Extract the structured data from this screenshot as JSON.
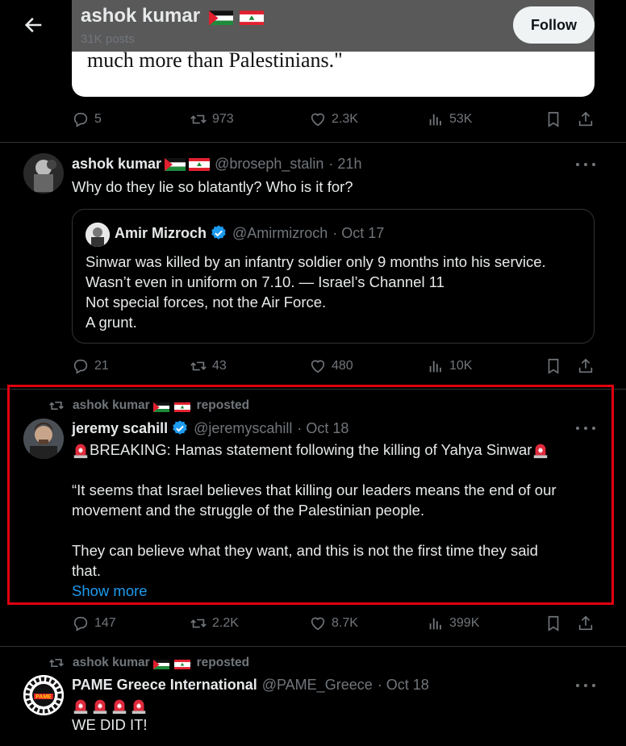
{
  "header": {
    "name": "ashok kumar",
    "posts": "31K posts",
    "follow_label": "Follow"
  },
  "top_card": {
    "text": "much more than Palestinians.\""
  },
  "action_bar_1": {
    "replies": "5",
    "reposts": "973",
    "likes": "2.3K",
    "views": "53K"
  },
  "tweet2": {
    "name": "ashok kumar",
    "handle": "@broseph_stalin",
    "time": "· 21h",
    "text": "Why do they lie so blatantly? Who is it for?",
    "quote": {
      "name": "Amir Mizroch",
      "handle": "@Amirmizroch",
      "time": "· Oct 17",
      "lines": [
        "Sinwar was killed by an infantry soldier only 9 months into his service.",
        "Wasn’t even in uniform on 7.10. — Israel’s Channel 11",
        "Not special forces, not the Air Force.",
        "A grunt."
      ]
    },
    "actions": {
      "replies": "21",
      "reposts": "43",
      "likes": "480",
      "views": "10K"
    }
  },
  "tweet3": {
    "social": "ashok kumar",
    "social_suffix": "reposted",
    "name": "jeremy scahill",
    "handle": "@jeremyscahill",
    "time": "· Oct 18",
    "line1": "BREAKING: Hamas statement following the killing of Yahya Sinwar",
    "para1_l1": "“It seems that Israel believes that killing our leaders means the end of our",
    "para1_l2": "movement and the struggle of the Palestinian people.",
    "para2_l1": "They can believe what they want, and this is not the first time they said",
    "para2_l2": "that.",
    "show_more": "Show more",
    "actions": {
      "replies": "147",
      "reposts": "2.2K",
      "likes": "8.7K",
      "views": "399K"
    }
  },
  "tweet4": {
    "social": "ashok kumar",
    "social_suffix": "reposted",
    "name": "PAME Greece International",
    "handle": "@PAME_Greece",
    "time": "· Oct 18",
    "text": "WE DID IT!",
    "avatar_text": "PAME"
  },
  "colors": {
    "accent": "#1d9bf0",
    "highlight": "#e0000f",
    "muted": "#71767b",
    "bg": "#000000"
  }
}
